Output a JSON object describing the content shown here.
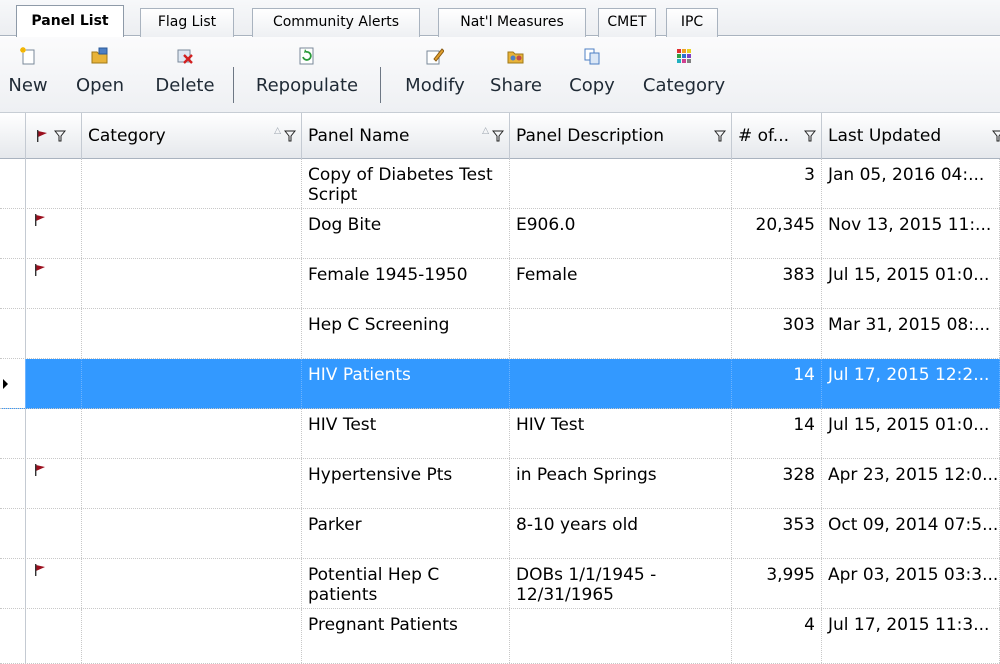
{
  "tabs": [
    {
      "label": "Panel List",
      "active": true
    },
    {
      "label": "Flag List",
      "active": false
    },
    {
      "label": "Community Alerts",
      "active": false
    },
    {
      "label": "Nat'l Measures",
      "active": false
    },
    {
      "label": "CMET",
      "active": false
    },
    {
      "label": "IPC",
      "active": false
    }
  ],
  "toolbar": {
    "new_label": "New",
    "open_label": "Open",
    "delete_label": "Delete",
    "repopulate_label": "Repopulate",
    "modify_label": "Modify",
    "share_label": "Share",
    "copy_label": "Copy",
    "category_label": "Category"
  },
  "icons": {
    "new": "new-document-icon",
    "open": "open-folder-icon",
    "delete": "delete-icon",
    "repopulate": "repopulate-icon",
    "modify": "modify-icon",
    "share": "share-icon",
    "copy": "copy-icon",
    "category": "category-grid-icon",
    "flag": "flag-icon",
    "filter": "filter-funnel-icon"
  },
  "colors": {
    "selection": "#3399ff",
    "flag": "#9b0f1e"
  },
  "columns": {
    "category": "Category",
    "panel_name": "Panel Name",
    "panel_description": "Panel Description",
    "count": "# of...",
    "last_updated": "Last Updated"
  },
  "rows": [
    {
      "flag": false,
      "category": "",
      "name": "Copy of Diabetes Test Script",
      "description": "",
      "count": "3",
      "updated": "Jan 05, 2016 04:...",
      "selected": false
    },
    {
      "flag": true,
      "category": "",
      "name": "Dog Bite",
      "description": "E906.0",
      "count": "20,345",
      "updated": "Nov 13, 2015 11:...",
      "selected": false
    },
    {
      "flag": true,
      "category": "",
      "name": "Female 1945-1950",
      "description": "Female",
      "count": "383",
      "updated": "Jul 15, 2015 01:0...",
      "selected": false
    },
    {
      "flag": false,
      "category": "",
      "name": "Hep C Screening",
      "description": "",
      "count": "303",
      "updated": "Mar 31, 2015 08:...",
      "selected": false
    },
    {
      "flag": false,
      "category": "",
      "name": "HIV Patients",
      "description": "",
      "count": "14",
      "updated": "Jul 17, 2015 12:2...",
      "selected": true
    },
    {
      "flag": false,
      "category": "",
      "name": "HIV Test",
      "description": "HIV Test",
      "count": "14",
      "updated": "Jul 15, 2015 01:0...",
      "selected": false
    },
    {
      "flag": true,
      "category": "",
      "name": "Hypertensive Pts",
      "description": "in Peach Springs",
      "count": "328",
      "updated": "Apr 23, 2015 12:0...",
      "selected": false
    },
    {
      "flag": false,
      "category": "",
      "name": "Parker",
      "description": "8-10 years old",
      "count": "353",
      "updated": "Oct 09, 2014 07:5...",
      "selected": false
    },
    {
      "flag": true,
      "category": "",
      "name": "Potential Hep C patients",
      "description": "DOBs 1/1/1945 - 12/31/1965",
      "count": "3,995",
      "updated": "Apr 03, 2015 03:3...",
      "selected": false
    },
    {
      "flag": false,
      "category": "",
      "name": "Pregnant Patients",
      "description": "",
      "count": "4",
      "updated": "Jul 17, 2015 11:3...",
      "selected": false
    }
  ]
}
